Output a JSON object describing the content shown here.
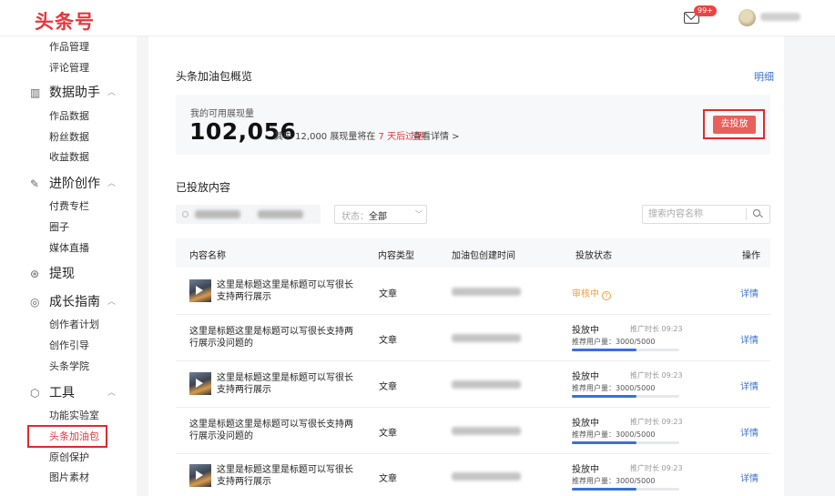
{
  "header": {
    "logo": "头条号",
    "badge": "99+"
  },
  "sidebar": {
    "items_top": [
      "作品管理",
      "评论管理"
    ],
    "groups": [
      {
        "label": "数据助手",
        "icon": "bar-chart-icon",
        "items": [
          "作品数据",
          "粉丝数据",
          "收益数据"
        ]
      },
      {
        "label": "进阶创作",
        "icon": "edit-icon",
        "items": [
          "付费专栏",
          "圈子",
          "媒体直播"
        ]
      },
      {
        "label": "提现",
        "icon": "yuan-coin-icon",
        "items": []
      },
      {
        "label": "成长指南",
        "icon": "compass-icon",
        "items": [
          "创作者计划",
          "创作引导",
          "头条学院"
        ]
      },
      {
        "label": "工具",
        "icon": "box-icon",
        "items": [
          "功能实验室",
          "头条加油包",
          "原创保护",
          "图片素材"
        ]
      }
    ],
    "active": "头条加油包"
  },
  "overview": {
    "title": "头条加油包概览",
    "detail_link": "明细",
    "label": "我的可用展现量",
    "value": "102,056",
    "note_prefix": "其中 12,000 展现量将在",
    "note_highlight": "7 天后过期",
    "more": "查看详情 >",
    "go_button": "去投放"
  },
  "placed": {
    "title": "已投放内容",
    "status_label": "状态：",
    "status_value": "全部",
    "search_placeholder": "搜索内容名称"
  },
  "table": {
    "headers": [
      "内容名称",
      "内容类型",
      "加油包创建时间",
      "投放状态",
      "操作"
    ],
    "rows": [
      {
        "has_thumb": true,
        "title_1": "这里是标题这里是标题可以写很长",
        "title_2": "支持两行展示",
        "type": "文章",
        "status": "审核中",
        "action": "详情"
      },
      {
        "has_thumb": false,
        "title_1": "这里是标题这里是标题可以写很长支持两",
        "title_2": "行展示没问题的",
        "type": "文章",
        "status": "投放中",
        "duration": "推广时长 09:23",
        "production": "推荐用户量：3000/5000",
        "progress": 0.6,
        "action": "详情"
      },
      {
        "has_thumb": true,
        "title_1": "这里是标题这里是标题可以写很长",
        "title_2": "支持两行展示",
        "type": "文章",
        "status": "投放中",
        "duration": "推广时长 09:23",
        "production": "推荐用户量：3000/5000",
        "progress": 0.6,
        "action": "详情"
      },
      {
        "has_thumb": false,
        "title_1": "这里是标题这里是标题可以写很长支持两",
        "title_2": "行展示没问题的",
        "type": "文章",
        "status": "投放中",
        "duration": "推广时长 09:23",
        "production": "推荐用户量：3000/5000",
        "progress": 0.6,
        "action": "详情"
      },
      {
        "has_thumb": true,
        "title_1": "这里是标题这里是标题可以写很长",
        "title_2": "支持两行展示",
        "type": "文章",
        "status": "投放中",
        "duration": "推广时长 09:23",
        "production": "推荐用户量：3000/5000",
        "progress": 0.6,
        "action": "详情"
      }
    ]
  },
  "colors": {
    "brand": "#e8353b",
    "link": "#3c72ce",
    "progress": "#3a6fd8",
    "review": "#f39b38"
  }
}
